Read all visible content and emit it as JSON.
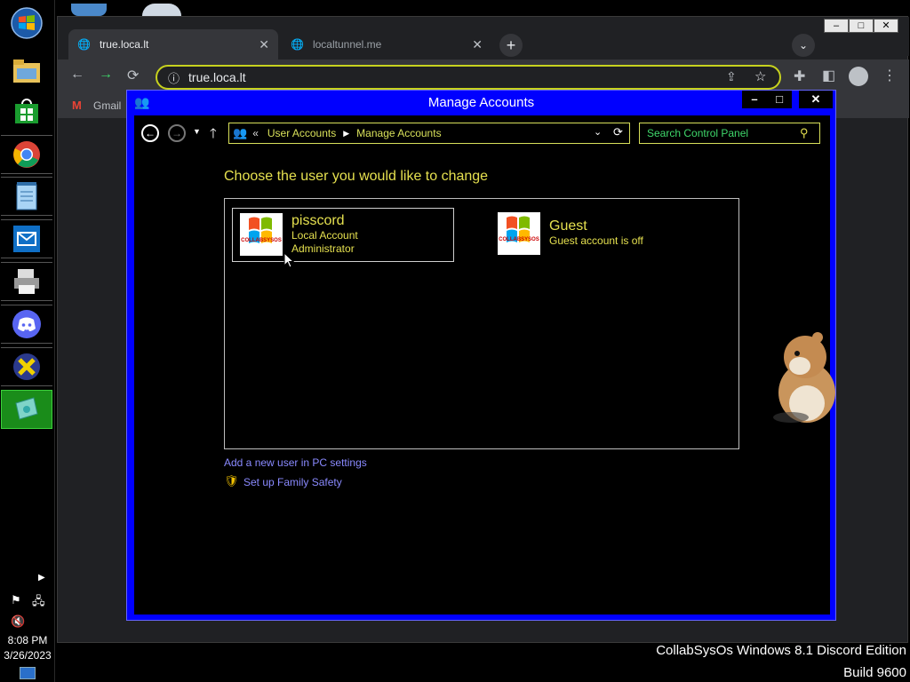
{
  "taskbar": {
    "items": [
      {
        "name": "start-orb-icon"
      },
      {
        "name": "file-explorer-icon"
      },
      {
        "name": "store-icon"
      },
      {
        "name": "chrome-icon"
      },
      {
        "name": "notepad-icon"
      },
      {
        "name": "mail-icon"
      },
      {
        "name": "printer-icon"
      },
      {
        "name": "discord-icon"
      },
      {
        "name": "x-app-icon"
      },
      {
        "name": "control-panel-icon"
      }
    ],
    "time": "8:08 PM",
    "date": "3/26/2023"
  },
  "browser": {
    "tabs": [
      {
        "label": "true.loca.lt",
        "active": true
      },
      {
        "label": "localtunnel.me",
        "active": false
      }
    ],
    "url": "true.loca.lt",
    "bookmark": "Gmail"
  },
  "window": {
    "title": "Manage Accounts",
    "breadcrumb_prefix": "«",
    "breadcrumb": [
      "User Accounts",
      "Manage Accounts"
    ],
    "search_placeholder": "Search Control Panel",
    "heading": "Choose the user you would like to change",
    "accounts": [
      {
        "name": "pisscord",
        "line1": "Local Account",
        "line2": "Administrator"
      },
      {
        "name": "Guest",
        "line1": "Guest account is off"
      }
    ],
    "links": {
      "add_user": "Add a new user in PC settings",
      "family_safety": "Set up Family Safety"
    },
    "avatar_logo_text": "COLLABSYSOS"
  },
  "footer": {
    "line1": "CollabSysOs Windows 8.1 Discord Edition",
    "line2": "Build 9600"
  },
  "colors": {
    "accent_blue": "#0000ff",
    "text_yellow": "#e5e04f",
    "link_blue": "#8a8aff",
    "taskbar_active": "#1a8c1a"
  }
}
